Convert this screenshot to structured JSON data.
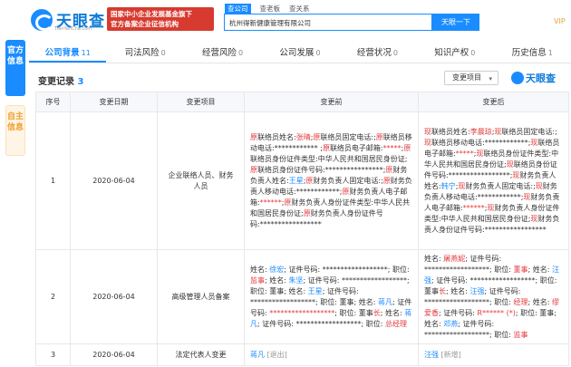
{
  "header": {
    "logo_text": "天眼查",
    "logo_sub": "TianYanCha.com",
    "banner_line1": "国家中小企业发展基金旗下",
    "banner_line2": "官方备案企业征信机构",
    "search_tabs": [
      "查公司",
      "查老板",
      "查关系"
    ],
    "search_value": "杭州得新健康管理有限公司",
    "search_button": "天眼一下",
    "vip": "VIP"
  },
  "side": {
    "tab1": "官方信息",
    "tab2": "自主信息"
  },
  "nav": [
    {
      "label": "公司背景",
      "count": "11"
    },
    {
      "label": "司法风险",
      "count": "0"
    },
    {
      "label": "经营风险",
      "count": "0"
    },
    {
      "label": "公司发展",
      "count": "0"
    },
    {
      "label": "经营状况",
      "count": "0"
    },
    {
      "label": "知识产权",
      "count": "0"
    },
    {
      "label": "历史信息",
      "count": "1"
    }
  ],
  "section": {
    "title": "变更记录",
    "count": "3",
    "select_label": "变更项目",
    "watermark": "天眼查"
  },
  "table": {
    "headers": [
      "序号",
      "变更日期",
      "变更项目",
      "变更前",
      "变更后"
    ],
    "rows": [
      {
        "idx": "1",
        "date": "2020-06-04",
        "item": "企业联络人员、财务人员",
        "before": [
          {
            "t": "原",
            "c": "hl"
          },
          {
            "t": "联络员姓名:"
          },
          {
            "t": "张晴",
            "c": "hl"
          },
          {
            "t": ";"
          },
          {
            "t": "原",
            "c": "hl"
          },
          {
            "t": "联络员固定电话:;"
          },
          {
            "t": "原",
            "c": "hl"
          },
          {
            "t": "联络员移动电话:************ ;"
          },
          {
            "t": "原",
            "c": "hl"
          },
          {
            "t": "联络员电子邮箱:"
          },
          {
            "t": "*****",
            "c": "hl"
          },
          {
            "t": ";"
          },
          {
            "t": "原",
            "c": "hl"
          },
          {
            "t": "联络员身份证件类型:中华人民共和国居民身份证;"
          },
          {
            "t": "原",
            "c": "hl"
          },
          {
            "t": "联络员身份证件号码:****************;"
          },
          {
            "t": "原",
            "c": "hl"
          },
          {
            "t": "财务负责人姓名:"
          },
          {
            "t": "王星",
            "c": "lk"
          },
          {
            "t": ";"
          },
          {
            "t": "原",
            "c": "hl"
          },
          {
            "t": "财务负责人固定电话:;"
          },
          {
            "t": "原",
            "c": "hl"
          },
          {
            "t": "财务负责人移动电话:************;"
          },
          {
            "t": "原",
            "c": "hl"
          },
          {
            "t": "财务负责人电子邮箱:"
          },
          {
            "t": "******",
            "c": "hl"
          },
          {
            "t": ";"
          },
          {
            "t": "原",
            "c": "hl"
          },
          {
            "t": "财务负责人身份证件类型:中华人民共和国居民身份证;"
          },
          {
            "t": "原",
            "c": "hl"
          },
          {
            "t": "财务负责人身份证件号码:*****************"
          }
        ],
        "after": [
          {
            "t": "现",
            "c": "hl"
          },
          {
            "t": "联络员姓名:"
          },
          {
            "t": "李晨琼",
            "c": "hl"
          },
          {
            "t": ";"
          },
          {
            "t": "现",
            "c": "hl"
          },
          {
            "t": "联络员固定电话:;"
          },
          {
            "t": "现",
            "c": "hl"
          },
          {
            "t": "联络员移动电话:************;"
          },
          {
            "t": "现",
            "c": "hl"
          },
          {
            "t": "联络员电子邮箱:"
          },
          {
            "t": "*****",
            "c": "hl"
          },
          {
            "t": ";"
          },
          {
            "t": "现",
            "c": "hl"
          },
          {
            "t": "联络员身份证件类型:中华人民共和国居民身份证;"
          },
          {
            "t": "现",
            "c": "hl"
          },
          {
            "t": "联络员身份证件号码:*****************;"
          },
          {
            "t": "现",
            "c": "hl"
          },
          {
            "t": "财务负责人姓名:"
          },
          {
            "t": "韩宁",
            "c": "lk"
          },
          {
            "t": ";"
          },
          {
            "t": "现",
            "c": "hl"
          },
          {
            "t": "财务负责人固定电话:;"
          },
          {
            "t": "现",
            "c": "hl"
          },
          {
            "t": "财务负责人移动电话:************;"
          },
          {
            "t": "现",
            "c": "hl"
          },
          {
            "t": "财务负责人电子邮箱:"
          },
          {
            "t": "******",
            "c": "hl"
          },
          {
            "t": ";"
          },
          {
            "t": "现",
            "c": "hl"
          },
          {
            "t": "财务负责人身份证件类型:中华人民共和国居民身份证;"
          },
          {
            "t": "现",
            "c": "hl"
          },
          {
            "t": "财务负责人身份证件号码:*****************"
          }
        ]
      },
      {
        "idx": "2",
        "date": "2020-06-04",
        "item": "高级管理人员备案",
        "before": [
          {
            "t": "姓名: "
          },
          {
            "t": "徐宏",
            "c": "lk"
          },
          {
            "t": "; 证件号码: ******************; 职位: "
          },
          {
            "t": "监事",
            "c": "hl"
          },
          {
            "t": "; 姓名: "
          },
          {
            "t": "朱坚",
            "c": "lk"
          },
          {
            "t": "; 证件号码: ******************; 职位: 董事; 姓名: "
          },
          {
            "t": "王星",
            "c": "lk"
          },
          {
            "t": "; 证件号码: ******************; 职位: 董事; 姓名: "
          },
          {
            "t": "蒋凡",
            "c": "lk"
          },
          {
            "t": "; 证件号码: "
          },
          {
            "t": "******************",
            "c": "hl"
          },
          {
            "t": "; 职位: 董事"
          },
          {
            "t": "长",
            "c": "hl"
          },
          {
            "t": "; 姓名: "
          },
          {
            "t": "蒋凡",
            "c": "lk"
          },
          {
            "t": "; 证件号码: ******************; 职位: "
          },
          {
            "t": "总经理",
            "c": "hl"
          }
        ],
        "after": [
          {
            "t": "姓名: "
          },
          {
            "t": "屠燕妮",
            "c": "hl"
          },
          {
            "t": "; 证件号码: ******************; 职位: "
          },
          {
            "t": "董事",
            "c": "hl"
          },
          {
            "t": "; 姓名: "
          },
          {
            "t": "汪强",
            "c": "lk"
          },
          {
            "t": "; 证件号码: ******************; 职位: 董事"
          },
          {
            "t": "长",
            "c": "hl"
          },
          {
            "t": "; 姓名: "
          },
          {
            "t": "汪强",
            "c": "lk"
          },
          {
            "t": "; 证件号码: ******************; 职位: "
          },
          {
            "t": "经理",
            "c": "hl"
          },
          {
            "t": "; 姓名: "
          },
          {
            "t": "缪爱香",
            "c": "hl"
          },
          {
            "t": "; 证件号码: "
          },
          {
            "t": "R****** (*)",
            "c": "hl"
          },
          {
            "t": "; 职位: 董事; 姓名: "
          },
          {
            "t": "邓燕",
            "c": "lk"
          },
          {
            "t": "; 证件号码: ******************; 职位: "
          },
          {
            "t": "监事",
            "c": "hl"
          }
        ]
      },
      {
        "idx": "3",
        "date": "2020-06-04",
        "item": "法定代表人变更",
        "before": [
          {
            "t": "蒋凡",
            "c": "lk"
          },
          {
            "t": " "
          },
          {
            "t": "[退出]",
            "c": "mt"
          }
        ],
        "after": [
          {
            "t": "汪强",
            "c": "lk"
          },
          {
            "t": " "
          },
          {
            "t": "[新增]",
            "c": "mt"
          }
        ]
      }
    ]
  },
  "colors": {
    "accent": "#1a8cff",
    "highlight": "#e4393c",
    "banner": "#d73a2f",
    "side_secondary": "#f0a030"
  }
}
